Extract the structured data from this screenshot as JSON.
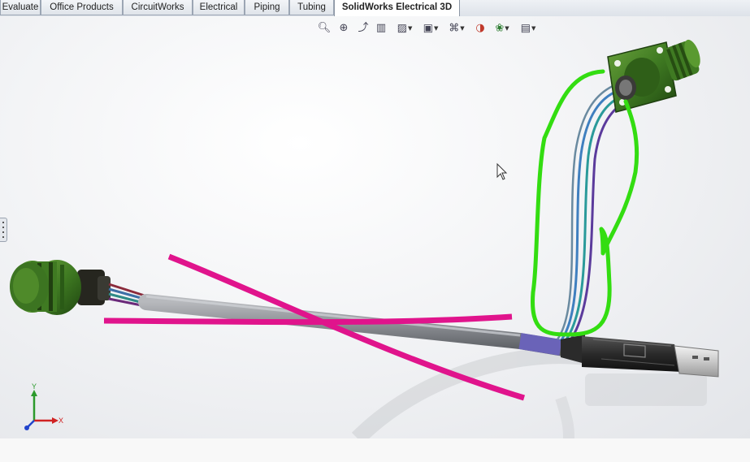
{
  "command_manager": {
    "tabs": [
      {
        "label": "Evaluate",
        "active": false
      },
      {
        "label": "Office Products",
        "active": false
      },
      {
        "label": "CircuitWorks",
        "active": false
      },
      {
        "label": "Electrical",
        "active": false
      },
      {
        "label": "Piping",
        "active": false
      },
      {
        "label": "Tubing",
        "active": false
      },
      {
        "label": "SolidWorks Electrical 3D",
        "active": true
      }
    ]
  },
  "view_toolbar": {
    "icons": [
      "zoom-to-fit-icon",
      "zoom-to-area-icon",
      "previous-view-icon",
      "section-view-icon",
      "view-orientation-icon",
      "display-style-icon",
      "hide-show-items-icon",
      "edit-appearance-icon",
      "apply-scene-icon",
      "view-settings-icon"
    ]
  },
  "triad": {
    "x_label": "X",
    "y_label": "Y"
  },
  "colors": {
    "highlight_green": "#33dd11",
    "strike_magenta": "#e0148c",
    "connector_green": "#3f7a22",
    "cable_gray": "#8a8d92"
  }
}
